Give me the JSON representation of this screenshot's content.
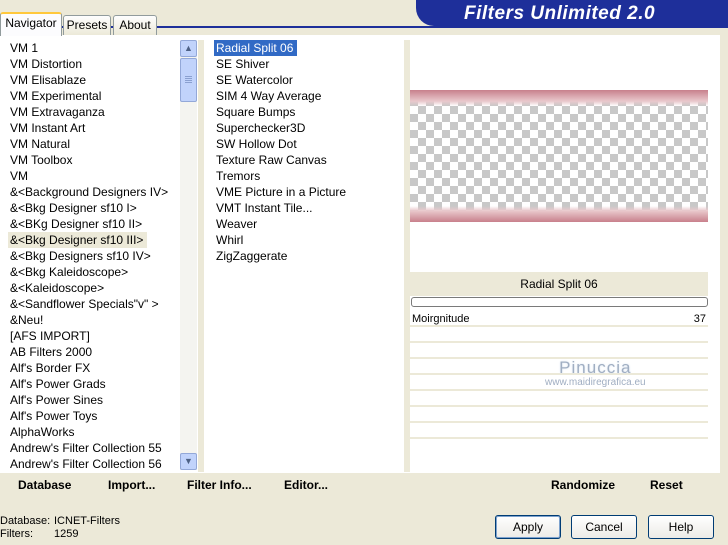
{
  "title": "Filters Unlimited 2.0",
  "tabs": [
    "Navigator",
    "Presets",
    "About"
  ],
  "categories": [
    "VM 1",
    "VM Distortion",
    "VM Elisablaze",
    "VM Experimental",
    "VM Extravaganza",
    "VM Instant Art",
    "VM Natural",
    "VM Toolbox",
    "VM",
    "&<Background Designers IV>",
    "&<Bkg Designer sf10 I>",
    "&<BKg Designer sf10 II>",
    "&<Bkg Designer sf10 III>",
    "&<Bkg Designers sf10 IV>",
    "&<Bkg Kaleidoscope>",
    "&<Kaleidoscope>",
    "&<Sandflower Specials\"v\" >",
    "&Neu!",
    "[AFS IMPORT]",
    "AB Filters 2000",
    "Alf's Border FX",
    "Alf's Power Grads",
    "Alf's Power Sines",
    "Alf's Power Toys",
    "AlphaWorks",
    "Andrew's Filter Collection 55",
    "Andrew's Filter Collection 56"
  ],
  "highlighted_category": "&<Bkg Designer sf10 III>",
  "filters": [
    "Radial Split 06",
    "SE Shiver",
    "SE Watercolor",
    "SIM 4 Way Average",
    "Square Bumps",
    "Superchecker3D",
    "SW Hollow Dot",
    "Texture Raw Canvas",
    "Tremors",
    "VME Picture in a Picture",
    "VMT Instant Tile...",
    "Weaver",
    "Whirl",
    "ZigZaggerate"
  ],
  "selected_filter": "Radial Split 06",
  "preview_label": "Radial Split 06",
  "progress": 0,
  "params": [
    {
      "label": "Moirgnitude",
      "value": "37"
    }
  ],
  "watermark": {
    "line1": "Pinuccia",
    "line2": "www.maidiregrafica.eu"
  },
  "toolbar": {
    "database": "Database",
    "import": "Import...",
    "filter_info": "Filter Info...",
    "editor": "Editor...",
    "randomize": "Randomize",
    "reset": "Reset"
  },
  "footer": {
    "database_label": "Database:",
    "database_value": "ICNET-Filters",
    "filters_label": "Filters:",
    "filters_value": "1259"
  },
  "buttons": {
    "apply": "Apply",
    "cancel": "Cancel",
    "help": "Help"
  }
}
